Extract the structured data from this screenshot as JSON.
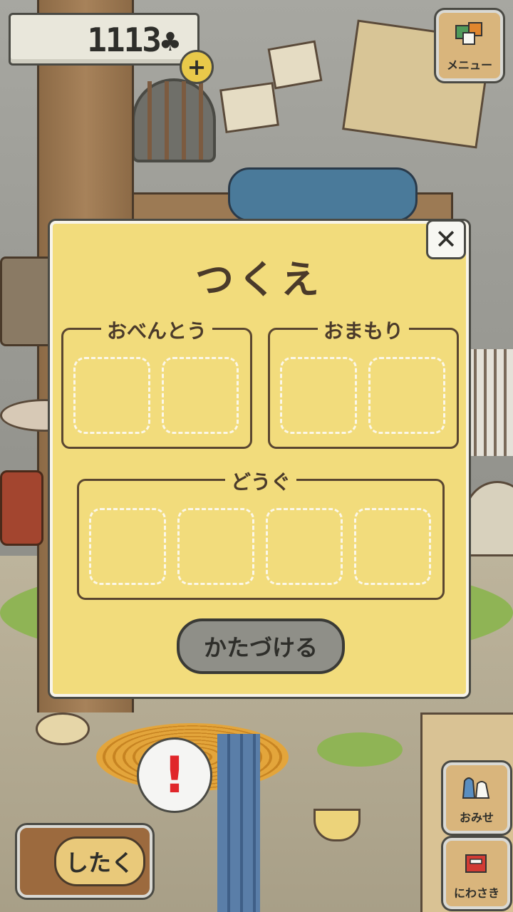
{
  "hud": {
    "clover_count": "1113",
    "clover_symbol": "♣",
    "plus_label": "+"
  },
  "buttons": {
    "menu_label": "メニュー",
    "shop_label": "おみせ",
    "garden_label": "にわさき",
    "prepare_label": "したく"
  },
  "dialog": {
    "title": "つくえ",
    "close_symbol": "✕",
    "groups": {
      "bento": {
        "label": "おべんとう",
        "slots": 2
      },
      "omamori": {
        "label": "おまもり",
        "slots": 2
      },
      "dougu": {
        "label": "どうぐ",
        "slots": 4
      }
    },
    "tidy_button": "かたづける"
  },
  "scene": {
    "alert_mark": "!"
  },
  "colors": {
    "dialog_bg": "#f2dc7c",
    "slot_border": "#fbf7e8",
    "button_gray": "#8f8f88",
    "alert_red": "#e0262a"
  }
}
